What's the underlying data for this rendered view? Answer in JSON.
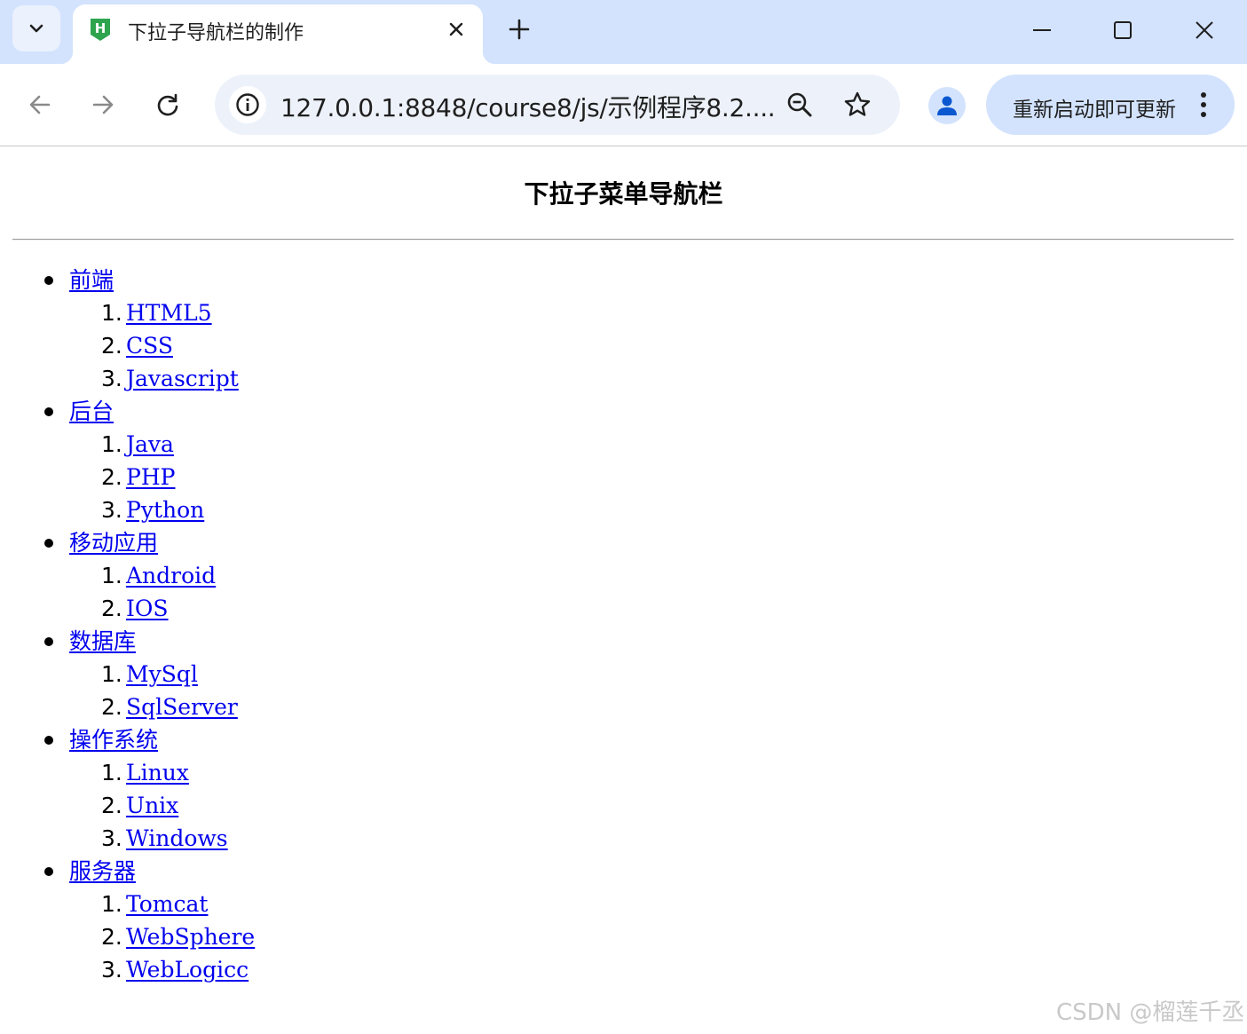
{
  "browser": {
    "tab_title": "下拉子导航栏的制作",
    "favicon_letter": "H",
    "url": "127.0.0.1:8848/course8/js/示例程序8.2....",
    "update_label": "重新启动即可更新",
    "accent": "#d3e3fd"
  },
  "page": {
    "title": "下拉子菜单导航栏",
    "menu": [
      {
        "label": "前端",
        "children": [
          {
            "n": "1.",
            "label": "HTML5"
          },
          {
            "n": "2.",
            "label": "CSS"
          },
          {
            "n": "3.",
            "label": "Javascript"
          }
        ]
      },
      {
        "label": "后台",
        "children": [
          {
            "n": "1.",
            "label": "Java"
          },
          {
            "n": "2.",
            "label": "PHP"
          },
          {
            "n": "3.",
            "label": "Python"
          }
        ]
      },
      {
        "label": "移动应用",
        "children": [
          {
            "n": "1.",
            "label": "Android"
          },
          {
            "n": "2.",
            "label": "IOS"
          }
        ]
      },
      {
        "label": "数据库",
        "children": [
          {
            "n": "1.",
            "label": "MySql"
          },
          {
            "n": "2.",
            "label": "SqlServer"
          }
        ]
      },
      {
        "label": "操作系统",
        "children": [
          {
            "n": "1.",
            "label": "Linux"
          },
          {
            "n": "2.",
            "label": "Unix"
          },
          {
            "n": "3.",
            "label": "Windows"
          }
        ]
      },
      {
        "label": "服务器",
        "children": [
          {
            "n": "1.",
            "label": "Tomcat"
          },
          {
            "n": "2.",
            "label": "WebSphere"
          },
          {
            "n": "3.",
            "label": "WebLogicc"
          }
        ]
      }
    ],
    "link_color": "#0000ee"
  },
  "watermark": "CSDN @榴莲千丞"
}
